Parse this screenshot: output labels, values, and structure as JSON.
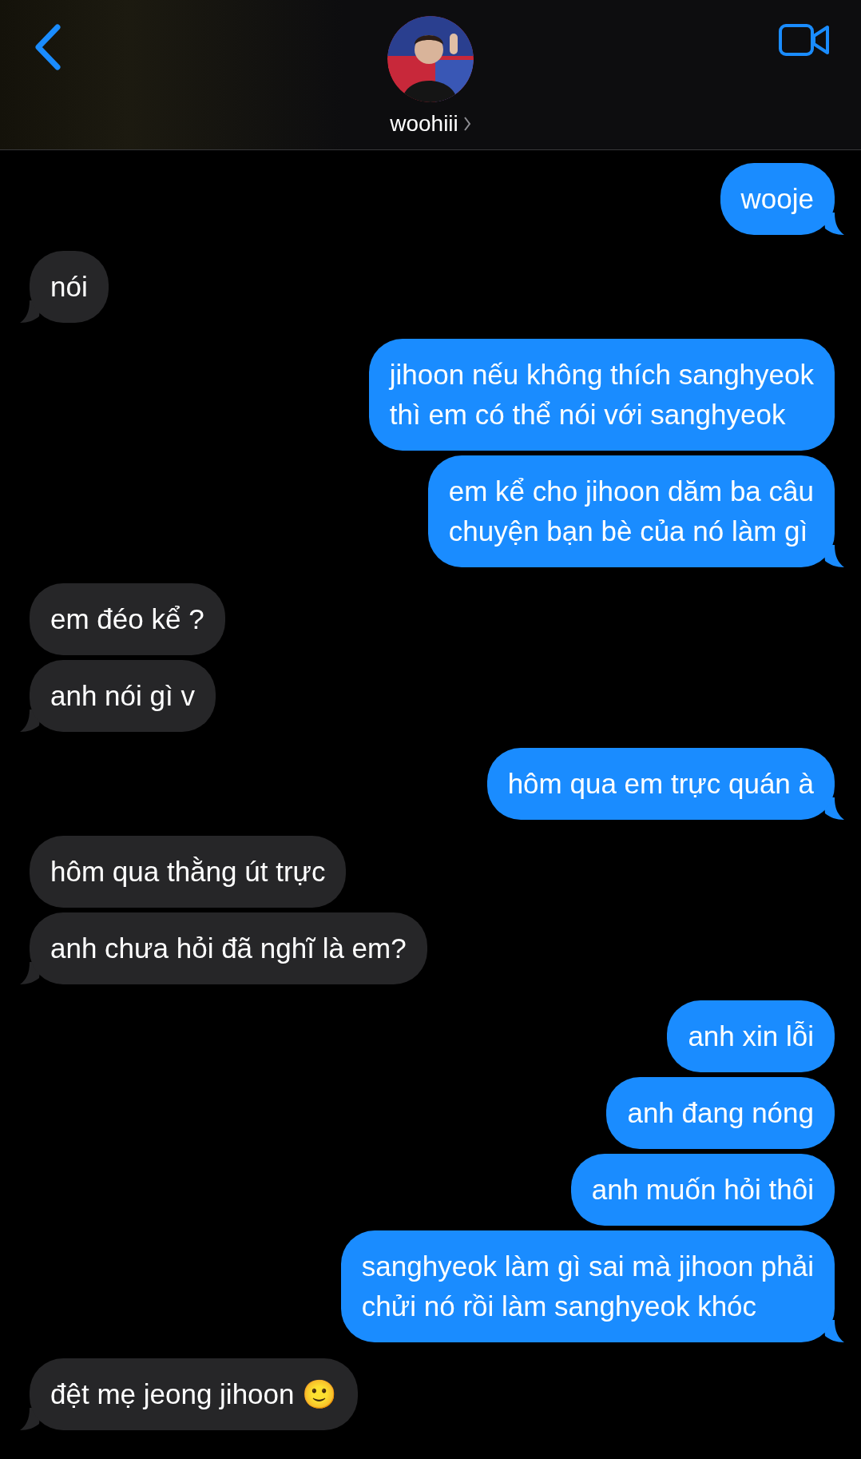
{
  "header": {
    "contact_name": "woohiii"
  },
  "messages": [
    {
      "kind": "sent",
      "text": "wooje",
      "tail": true
    },
    {
      "kind": "received",
      "text": "nói",
      "tail": true
    },
    {
      "kind": "sent",
      "text": "jihoon nếu không thích sanghyeok\nthì em có thể nói với sanghyeok",
      "tail": false
    },
    {
      "kind": "sent",
      "text": "em kể cho jihoon dăm ba câu\nchuyện bạn bè của nó làm gì",
      "tail": true
    },
    {
      "kind": "received",
      "text": "em đéo kể ?",
      "tail": false
    },
    {
      "kind": "received",
      "text": "anh nói gì v",
      "tail": true
    },
    {
      "kind": "sent",
      "text": "hôm qua em trực quán à",
      "tail": true
    },
    {
      "kind": "received",
      "text": "hôm qua thằng út trực",
      "tail": false
    },
    {
      "kind": "received",
      "text": "anh chưa hỏi đã nghĩ là em?",
      "tail": true
    },
    {
      "kind": "sent",
      "text": "anh xin lỗi",
      "tail": false
    },
    {
      "kind": "sent",
      "text": "anh đang nóng",
      "tail": false
    },
    {
      "kind": "sent",
      "text": "anh muốn hỏi thôi",
      "tail": false
    },
    {
      "kind": "sent",
      "text": "sanghyeok làm gì sai mà jihoon phải\nchửi nó rồi làm sanghyeok khóc",
      "tail": true
    },
    {
      "kind": "received",
      "text": "đệt mẹ jeong jihoon 🙂",
      "tail": true
    }
  ]
}
